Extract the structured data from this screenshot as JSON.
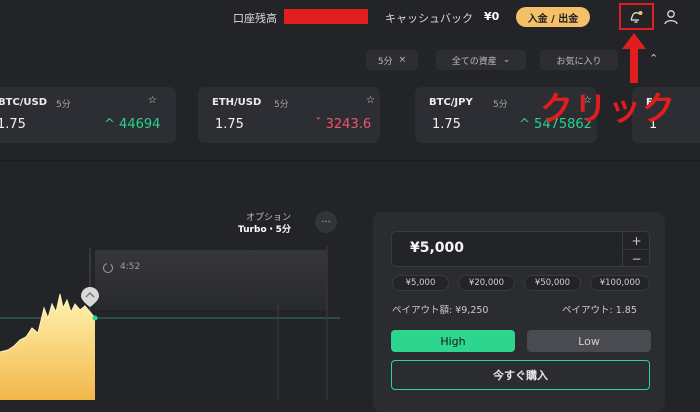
{
  "header": {
    "balance_label": "口座残高",
    "cashback_label": "キャッシュバック",
    "cashback_value": "¥0",
    "deposit_button": "入金 / 出金"
  },
  "filters": {
    "timeframe": "5分",
    "timeframe_close": "×",
    "all_assets": "全ての資産",
    "favorites": "お気に入り"
  },
  "annotation": {
    "click_text": "クリック"
  },
  "cards": [
    {
      "name": "BTC/USD",
      "timeframe": "5分",
      "rate": "1.75",
      "price": "44694",
      "trend": "up",
      "arrow": "^"
    },
    {
      "name": "ETH/USD",
      "timeframe": "5分",
      "rate": "1.75",
      "price": "3243.6",
      "trend": "down",
      "arrow": "ˇ"
    },
    {
      "name": "BTC/JPY",
      "timeframe": "5分",
      "rate": "1.75",
      "price": "5475862",
      "trend": "up",
      "arrow": "^"
    },
    {
      "name": "E",
      "timeframe": "",
      "rate": "1",
      "price": "",
      "trend": "up",
      "arrow": ""
    }
  ],
  "chart": {
    "option_label": "オプション",
    "turbo_label": "Turbo・5分",
    "timer": "4:52",
    "more": "···"
  },
  "trade": {
    "amount": "¥5,000",
    "plus": "+",
    "minus": "−",
    "presets": [
      "¥5,000",
      "¥20,000",
      "¥50,000",
      "¥100,000"
    ],
    "payout_amount": "ペイアウト額: ¥9,250",
    "payout_rate": "ペイアウト: 1.85",
    "high": "High",
    "low": "Low",
    "buy_now": "今すぐ購入"
  },
  "colors": {
    "background": "#232428",
    "up": "#2bd18d",
    "down": "#f0536a",
    "deposit": "#f4c06a",
    "annotation": "#e11d1d"
  }
}
